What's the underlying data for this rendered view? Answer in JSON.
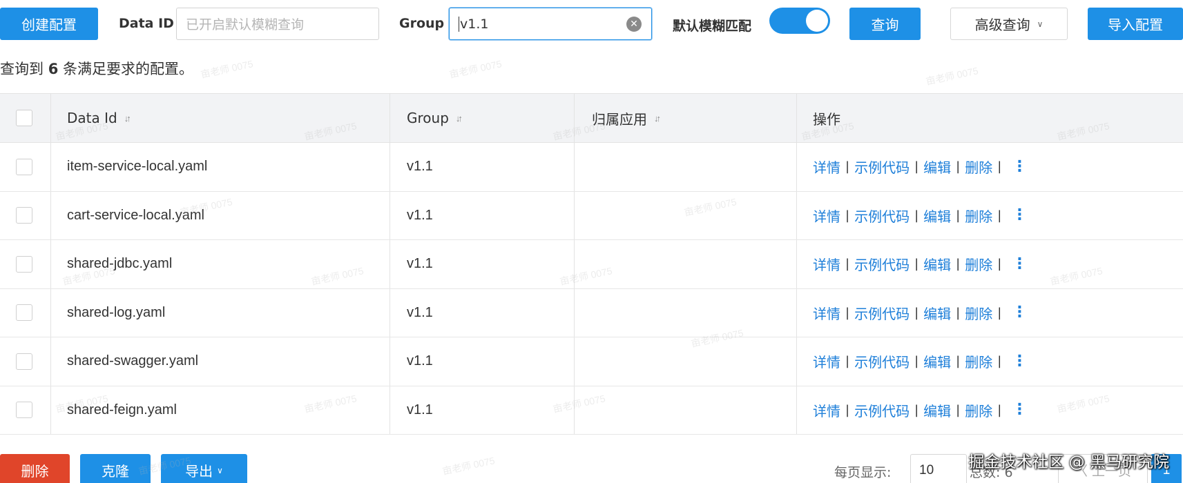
{
  "toolbar": {
    "create_button": "创建配置",
    "data_id_label": "Data ID",
    "data_id_placeholder": "已开启默认模糊查询",
    "group_label": "Group",
    "group_value": "v1.1",
    "fuzzy_label": "默认模糊匹配",
    "fuzzy_enabled": true,
    "search_button": "查询",
    "advanced_button": "高级查询",
    "import_button": "导入配置"
  },
  "summary": {
    "prefix": "查询到",
    "count": "6",
    "suffix": "条满足要求的配置。"
  },
  "table": {
    "headers": {
      "data_id": "Data Id",
      "group": "Group",
      "app": "归属应用",
      "actions": "操作"
    },
    "rows": [
      {
        "data_id": "item-service-local.yaml",
        "group": "v1.1",
        "app": ""
      },
      {
        "data_id": "cart-service-local.yaml",
        "group": "v1.1",
        "app": ""
      },
      {
        "data_id": "shared-jdbc.yaml",
        "group": "v1.1",
        "app": ""
      },
      {
        "data_id": "shared-log.yaml",
        "group": "v1.1",
        "app": ""
      },
      {
        "data_id": "shared-swagger.yaml",
        "group": "v1.1",
        "app": ""
      },
      {
        "data_id": "shared-feign.yaml",
        "group": "v1.1",
        "app": ""
      }
    ],
    "actions": {
      "detail": "详情",
      "sample_code": "示例代码",
      "edit": "编辑",
      "delete": "删除",
      "separator": "|"
    }
  },
  "footer": {
    "delete_button": "删除",
    "clone_button": "克隆",
    "export_button": "导出",
    "page_size_label": "每页显示:",
    "page_size_value": "10",
    "total_label": "总数: 6",
    "prev_button": "〈 上一页",
    "current_page": "1"
  },
  "watermark": {
    "credit": "掘金技术社区 @ 黑马研究院",
    "faint_text": "亩老师 0075"
  },
  "colors": {
    "primary": "#1e90e6",
    "danger": "#e0452a",
    "link": "#1e7fd9"
  }
}
